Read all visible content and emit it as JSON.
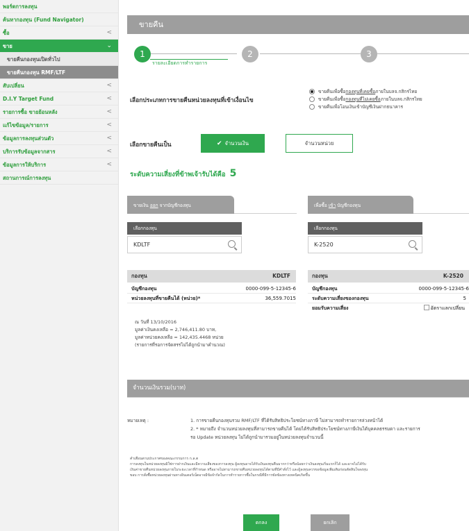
{
  "sidebar": {
    "items": [
      {
        "label": "พอร์ตการลงทุน",
        "chevron": ""
      },
      {
        "label": "ค้นหากองทุน (Fund Navigator)",
        "chevron": ""
      },
      {
        "label": "ซื้อ",
        "chevron": "<"
      },
      {
        "label": "ขาย",
        "chevron": "⌄"
      },
      {
        "label": "สับเปลี่ยน",
        "chevron": "<"
      },
      {
        "label": "D.I.Y Target Fund",
        "chevron": "<"
      },
      {
        "label": "รายการซื้อ ขายย้อนหลัง",
        "chevron": "<"
      },
      {
        "label": "แก้ไขข้อมูล/รายการ",
        "chevron": "<"
      },
      {
        "label": "ข้อมูลการลงทุนส่วนตัว",
        "chevron": "<"
      },
      {
        "label": "บริการรับข้อมูลจากสาร",
        "chevron": "<"
      },
      {
        "label": "ข้อมูลการให้บริการ",
        "chevron": "<"
      },
      {
        "label": "สถานการณ์การลงทุน",
        "chevron": ""
      }
    ],
    "sub_items": [
      "ขายคืนกองทุนเปิดทั่วไป",
      "ขายคืนกองทุน RMF/LTF"
    ]
  },
  "page": {
    "title": "ขายคืน",
    "steps": [
      "1",
      "2",
      "3"
    ],
    "step1_label": "รายละเอียดการทำรายการ"
  },
  "redeem_type": {
    "label": "เลือกประเภทการขายคืนหน่วยลงทุนที่เข้าเงื่อนไข",
    "options": [
      {
        "pre": "ขายคืนเพื่อซื้อ",
        "link": "กองทุนที่เคยซื้อ",
        "post": "ภายในบลจ.กสิกรไทย",
        "selected": true
      },
      {
        "pre": "ขายคืนเพื่อซื้อ",
        "link": "กองทุนที่ไม่เคยซื้อ",
        "post": "ภายในบลจ.กสิกรไทย",
        "selected": false
      },
      {
        "pre": "ขายคืนเพื่อโอนเงินเข้าบัญชีเงินฝากธนาคาร",
        "link": "",
        "post": "",
        "selected": false
      }
    ]
  },
  "redeem_as": {
    "label": "เลือกขายคืนเป็น",
    "amount_label": "จำนวนเงิน",
    "unit_label": "จำนวนหน่วย"
  },
  "risk": {
    "text": "ระดับความเสี่ยงที่ข้าพเจ้ารับได้คือ",
    "level": "5"
  },
  "from_panel": {
    "tab_pre": "ขายเงิน",
    "tab_link": "ออก",
    "tab_post": "จากบัญชีกองทุน",
    "search_header": "เลือกกองทุน",
    "search_value": "KDLTF",
    "fund_label": "กองทุน",
    "fund_value": "KDLTF",
    "account_label": "บัญชีกองทุน",
    "account_value": "0000-099-5-12345-6",
    "units_label": "หน่วยลงทุนที่ขายคืนได้ (หน่วย)*",
    "units_value": "36,559.7015",
    "asof_lines": [
      "ณ วันที่ 13/10/2016",
      "มูลค่าเงินคงเหลือ = 2,746,411.80 บาท,",
      "มูลค่าหน่วยคงเหลือ = 142,435.4468 หน่วย",
      "(รายการที่รอการจัดสรรไม่ได้ถูกนำมาคำนวณ)"
    ]
  },
  "to_panel": {
    "tab_pre": "เพื่อซื้อ",
    "tab_link": "เข้า",
    "tab_post": "บัญชีกองทุน",
    "search_header": "เลือกกองทุน",
    "search_value": "K-2520",
    "fund_label": "กองทุน",
    "fund_value": "K-2520",
    "account_label": "บัญชีกองทุน",
    "account_value": "0000-099-5-12345-6",
    "risk_label": "ระดับความเสี่ยงของกองทุน",
    "risk_value": "5",
    "accept_label": "ยอมรับความเสี่ยง",
    "accept_value": "อัตราแลกเปลี่ยน"
  },
  "total": {
    "label": "จำนวนเงินรวม(บาท)"
  },
  "remarks": {
    "label": "หมายเหตุ :",
    "lines": [
      "1. การขายคืนกองทุนรวม RMF/LTF ที่ได้รับสิทธิประโยชน์ทางภาษี ไม่สามารถทำรายการล่วงหน้าได้",
      "2. * หมายถึง จำนวนหน่วยลงทุนที่สามารถขายคืนได้ โดยได้รับสิทธิประโยชน์ทางภาษีเงินได้บุคคลธรรมดา และรายการ",
      "รอ Update หน่วยลงทุน ไม่ได้ถูกนำมารวมอยู่ในหน่วยลงทุนจำนวนนี้"
    ]
  },
  "disclaimer": {
    "title": "คำเตือนตามประกาศของคณะกรรมการ ก.ล.ต",
    "lines": [
      "การลงทุนในหน่วยลงทุนมิใช่การฝากเงินและมีความเสี่ยงของการลงทุน ผู้ลงทุนอาจได้รับเงินลงทุนคืนมากกว่าหรือน้อยกว่าเงินลงทุนเริ่มแรกก็ได้ และอาจไม่ได้รับ",
      "เงินค่าขายคืนหน่วยลงทุนภายในระยะเวลาที่กำหนด หรืออาจไม่สามารถขายคืนหน่วยลงทุนได้ตามที่มีคำสั่งไว้ และผู้ลงทุนควรขอข้อมูลเพิ่มเติมก่อนตัดสินใจลงทุน",
      "ขอบ การสั่งซื้อหน่วยลงทุนผ่านทางอินเตอร์เน็ตอาจมีข้อจำกัดในการทำรายการซื้อในกรณีที่มีการขัดข้องทางเทคนิคเกิดขึ้น"
    ]
  },
  "actions": {
    "ok_label": "ตกลง",
    "cancel_label": "ยกเลิก"
  },
  "colors": {
    "accent": "#2fa84f",
    "header_gray": "#9e9e9e",
    "dark_gray": "#606060"
  }
}
